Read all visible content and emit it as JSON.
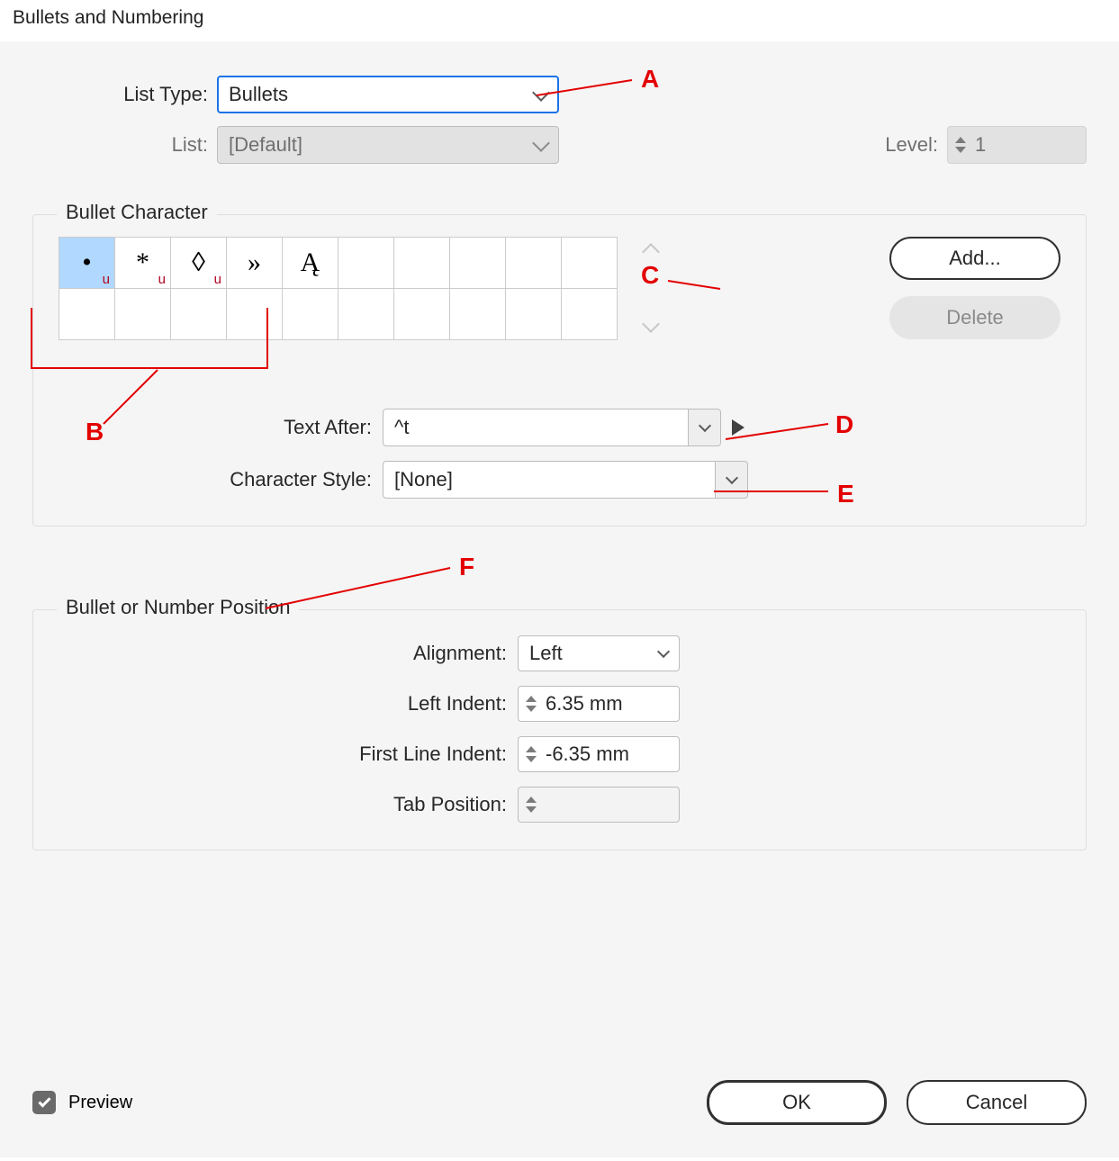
{
  "dialogTitle": "Bullets and Numbering",
  "labels": {
    "listType": "List Type:",
    "list": "List:",
    "level": "Level:",
    "textAfter": "Text After:",
    "charStyle": "Character Style:",
    "alignment": "Alignment:",
    "leftIndent": "Left Indent:",
    "firstLine": "First Line Indent:",
    "tabPos": "Tab Position:"
  },
  "values": {
    "listType": "Bullets",
    "list": "[Default]",
    "level": "1",
    "textAfter": "^t",
    "charStyle": "[None]",
    "alignment": "Left",
    "leftIndent": "6.35 mm",
    "firstLine": "-6.35 mm",
    "tabPos": ""
  },
  "legends": {
    "bulletChar": "Bullet Character",
    "position": "Bullet or Number Position"
  },
  "bulletGlyphs": [
    "•",
    "*",
    "◊",
    "»",
    "Ą"
  ],
  "buttons": {
    "add": "Add...",
    "delete": "Delete",
    "ok": "OK",
    "cancel": "Cancel"
  },
  "preview": "Preview",
  "annotations": {
    "A": "A",
    "B": "B",
    "C": "C",
    "D": "D",
    "E": "E",
    "F": "F"
  }
}
